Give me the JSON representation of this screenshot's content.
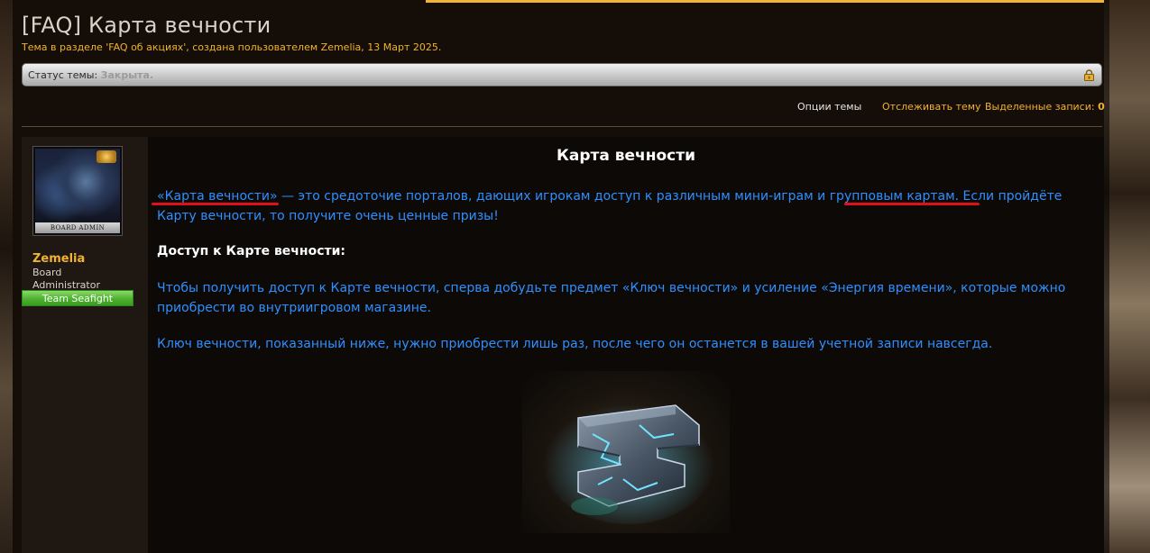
{
  "thread": {
    "title": "[FAQ] Карта вечности",
    "meta": "Тема в разделе 'FAQ об акциях', создана пользователем Zemelia, 13 Март 2025."
  },
  "status_bar": {
    "label": "Статус темы:",
    "value": "Закрыта."
  },
  "options": {
    "thread_options": "Опции темы",
    "watch_thread": "Отслеживать тему",
    "highlighted_posts": "Выделенные записи:",
    "highlighted_count": "0"
  },
  "author": {
    "avatar_caption": "BOARD ADMIN",
    "name": "Zemelia",
    "title": "Board Administrator",
    "team": "Team Seafight"
  },
  "post": {
    "heading": "Карта вечности",
    "intro_link": "«Карта вечности» —",
    "intro_text1": " это средоточие порталов, дающих игрокам доступ к различным мини-играм и ",
    "intro_link2": "групповым картам",
    "intro_text2": ". Если пройдёте Карту вечности, то получите очень ценные призы!",
    "access_heading": "Доступ к Карте вечности:",
    "access_text": "Чтобы получить доступ к Карте вечности, сперва добудьте предмет «Ключ вечности» и усиление «Энергия времени», которые можно приобрести во внутриигровом магазине.",
    "key_text": "Ключ вечности, показанный ниже, нужно приобрести лишь раз, после чего он останется в вашей учетной записи навсегда."
  },
  "colors": {
    "accent": "#f2b233",
    "post_text": "#2f8fff",
    "highlight_underline": "#e0101a",
    "team_badge": "#4db32e"
  }
}
